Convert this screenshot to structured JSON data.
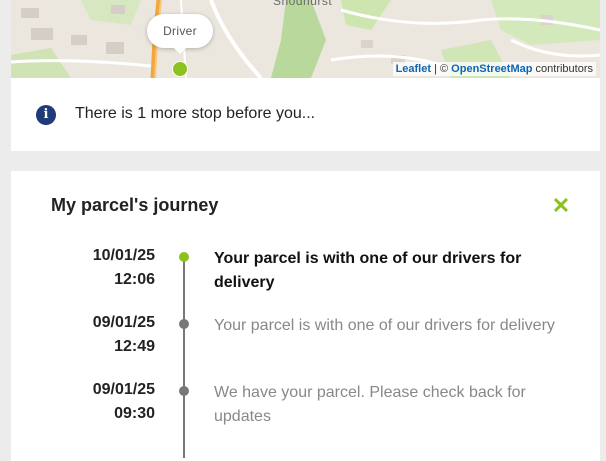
{
  "map": {
    "place_label": "Shodhurst",
    "driver_label": "Driver",
    "attribution": {
      "leaflet": "Leaflet",
      "separator": " | © ",
      "osm": "OpenStreetMap",
      "suffix": " contributors"
    }
  },
  "info": {
    "icon": "info-icon",
    "message": "There is 1 more stop before you..."
  },
  "journey": {
    "title": "My parcel's journey",
    "close_icon": "close-icon",
    "events": [
      {
        "date": "10/01/25",
        "time": "12:06",
        "text": "Your parcel is with one of our drivers for delivery",
        "current": true
      },
      {
        "date": "09/01/25",
        "time": "12:49",
        "text": "Your parcel is with one of our drivers for delivery",
        "current": false
      },
      {
        "date": "09/01/25",
        "time": "09:30",
        "text": "We have your parcel. Please check back for updates",
        "current": false
      }
    ]
  },
  "colors": {
    "accent": "#8cc21f",
    "info_icon": "#1f3c78",
    "link": "#0f64b4"
  }
}
